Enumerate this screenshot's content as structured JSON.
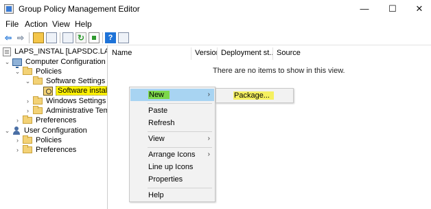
{
  "window": {
    "title": "Group Policy Management Editor",
    "minimize_glyph": "—",
    "maximize_glyph": "☐",
    "close_glyph": "✕"
  },
  "menu": [
    "File",
    "Action",
    "View",
    "Help"
  ],
  "toolbar": {
    "icons": [
      "back-arrow-icon",
      "forward-arrow-icon",
      "up-folder-icon",
      "show-hide-tree-icon",
      "properties-icon",
      "refresh-icon",
      "export-list-icon",
      "help-icon",
      "show-pane-icon"
    ],
    "back_glyph": "⇦",
    "forward_glyph": "⇨",
    "refresh_glyph": "↻",
    "help_glyph": "?"
  },
  "tree": {
    "root": "LAPS_INSTAL [LAPSDC.LAPS.CO",
    "computer_config": "Computer Configuration",
    "policies": "Policies",
    "software_settings": "Software Settings",
    "software_installation": "Software installat",
    "windows_settings": "Windows Settings",
    "admin_templates": "Administrative Temp",
    "preferences": "Preferences",
    "user_config": "User Configuration",
    "user_policies": "Policies",
    "user_preferences": "Preferences",
    "expanded_glyph": "⌄",
    "collapsed_glyph": "›"
  },
  "list": {
    "columns": [
      "Name",
      "Version",
      "Deployment st...",
      "Source"
    ],
    "empty_message": "There are no items to show in this view."
  },
  "context_menu": {
    "items": [
      "New",
      "Paste",
      "Refresh",
      "View",
      "Arrange Icons",
      "Line up Icons",
      "Properties",
      "Help"
    ],
    "submenu_arrow": "›"
  },
  "submenu": {
    "items": [
      "Package..."
    ]
  },
  "colors": {
    "highlight_blue": "#a8d4f2",
    "marker_green": "#7cd84a",
    "marker_yellow": "#fff200"
  }
}
